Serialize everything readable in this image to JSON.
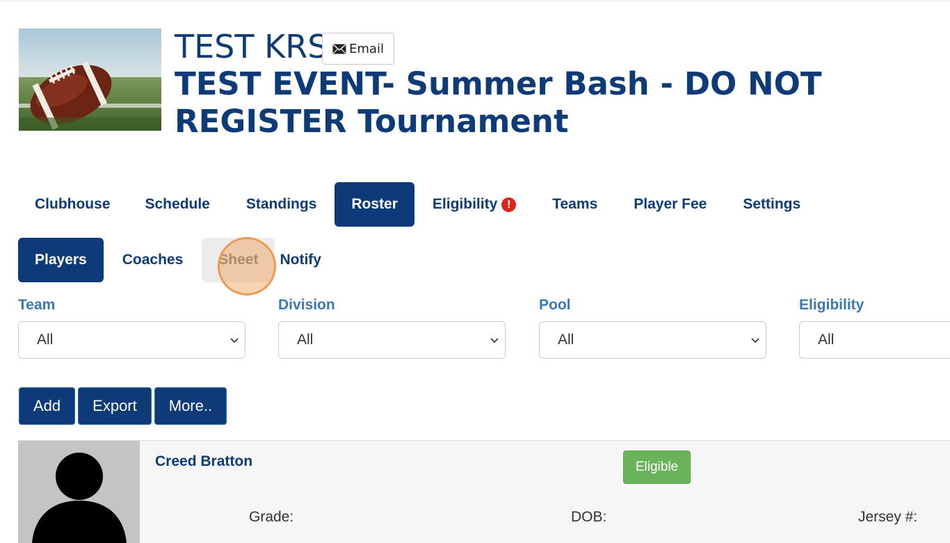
{
  "header": {
    "org_name": "TEST KRS",
    "email_label": "Email",
    "event_title": "TEST EVENT- Summer Bash - DO NOT REGISTER Tournament"
  },
  "main_nav": [
    {
      "label": "Clubhouse",
      "active": false
    },
    {
      "label": "Schedule",
      "active": false
    },
    {
      "label": "Standings",
      "active": false
    },
    {
      "label": "Roster",
      "active": true
    },
    {
      "label": "Eligibility",
      "active": false,
      "alert": "!"
    },
    {
      "label": "Teams",
      "active": false
    },
    {
      "label": "Player Fee",
      "active": false
    },
    {
      "label": "Settings",
      "active": false
    }
  ],
  "sub_nav": [
    {
      "label": "Players",
      "state": "active"
    },
    {
      "label": "Coaches",
      "state": "normal"
    },
    {
      "label": "Sheet",
      "state": "hover"
    },
    {
      "label": "Notify",
      "state": "normal"
    }
  ],
  "filters": [
    {
      "label": "Team",
      "value": "All"
    },
    {
      "label": "Division",
      "value": "All"
    },
    {
      "label": "Pool",
      "value": "All"
    },
    {
      "label": "Eligibility",
      "value": "All"
    }
  ],
  "actions": {
    "add": "Add",
    "export": "Export",
    "more": "More.."
  },
  "player": {
    "name": "Creed Bratton",
    "status": "Eligible",
    "grade_label": "Grade:",
    "dob_label": "DOB:",
    "jersey_label": "Jersey #:"
  },
  "colors": {
    "primary": "#0d3b78",
    "label_blue": "#3a78b5",
    "eligible_green": "#6ab35a",
    "alert_red": "#d9261c",
    "click_highlight": "#ef9a4f"
  }
}
